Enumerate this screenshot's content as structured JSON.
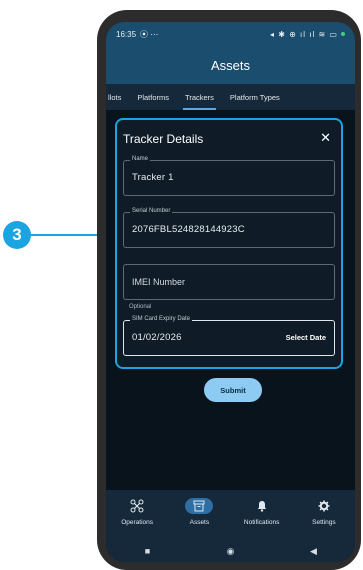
{
  "callout": {
    "number": "3"
  },
  "status_bar": {
    "time": "16:35",
    "left_icons": "⦿ ⋯",
    "right_icons": "◂ ✱ ⊕ ıl ıl ≋ ▭"
  },
  "app_bar": {
    "title": "Assets"
  },
  "tabs": [
    {
      "label": "llots",
      "active": false
    },
    {
      "label": "Platforms",
      "active": false
    },
    {
      "label": "Trackers",
      "active": true
    },
    {
      "label": "Platform Types",
      "active": false
    }
  ],
  "dialog": {
    "title": "Tracker Details",
    "close_icon": "✕",
    "name": {
      "label": "Name",
      "value": "Tracker 1"
    },
    "serial": {
      "label": "Serial Number",
      "value": "2076FBL524828144923C"
    },
    "imei": {
      "placeholder": "IMEI Number",
      "helper": "Optional"
    },
    "sim_expiry": {
      "label": "SIM Card Expiry Date",
      "value": "01/02/2026",
      "action": "Select Date"
    }
  },
  "submit_label": "Submit",
  "bottom_nav": [
    {
      "label": "Operations",
      "icon": "drone-icon",
      "active": false
    },
    {
      "label": "Assets",
      "icon": "archive-icon",
      "active": true
    },
    {
      "label": "Notifications",
      "icon": "bell-icon",
      "active": false
    },
    {
      "label": "Settings",
      "icon": "gear-icon",
      "active": false
    }
  ],
  "system_nav": {
    "recents": "■",
    "home": "◉",
    "back": "◀"
  },
  "colors": {
    "callout": "#1ba4e0",
    "app_bar": "#1b4d6f",
    "accent": "#8ecbf3"
  }
}
